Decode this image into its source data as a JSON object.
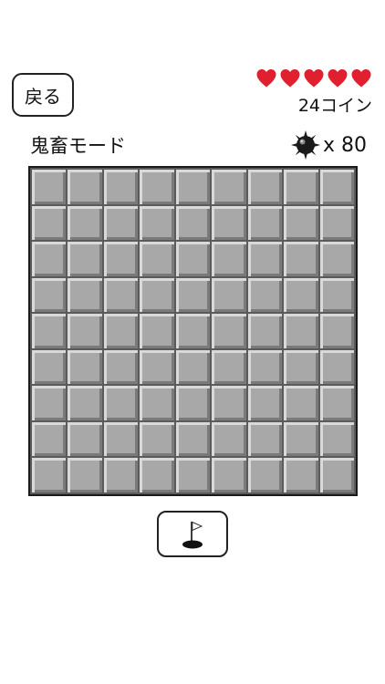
{
  "header": {
    "back_label": "戻る",
    "lives": 5,
    "lives_icon": "heart-icon",
    "coins_text": "24コイン"
  },
  "game": {
    "mode_label": "鬼畜モード",
    "mine_icon": "mine-icon",
    "mine_count_text": "x 80",
    "board": {
      "rows": 9,
      "cols": 9,
      "state": "all-hidden"
    }
  },
  "toolbar": {
    "flag_icon": "flag-hole-icon"
  },
  "colors": {
    "heart": "#e0202e",
    "cell": "#a8a8a8",
    "board_border": "#1a1a1a"
  }
}
